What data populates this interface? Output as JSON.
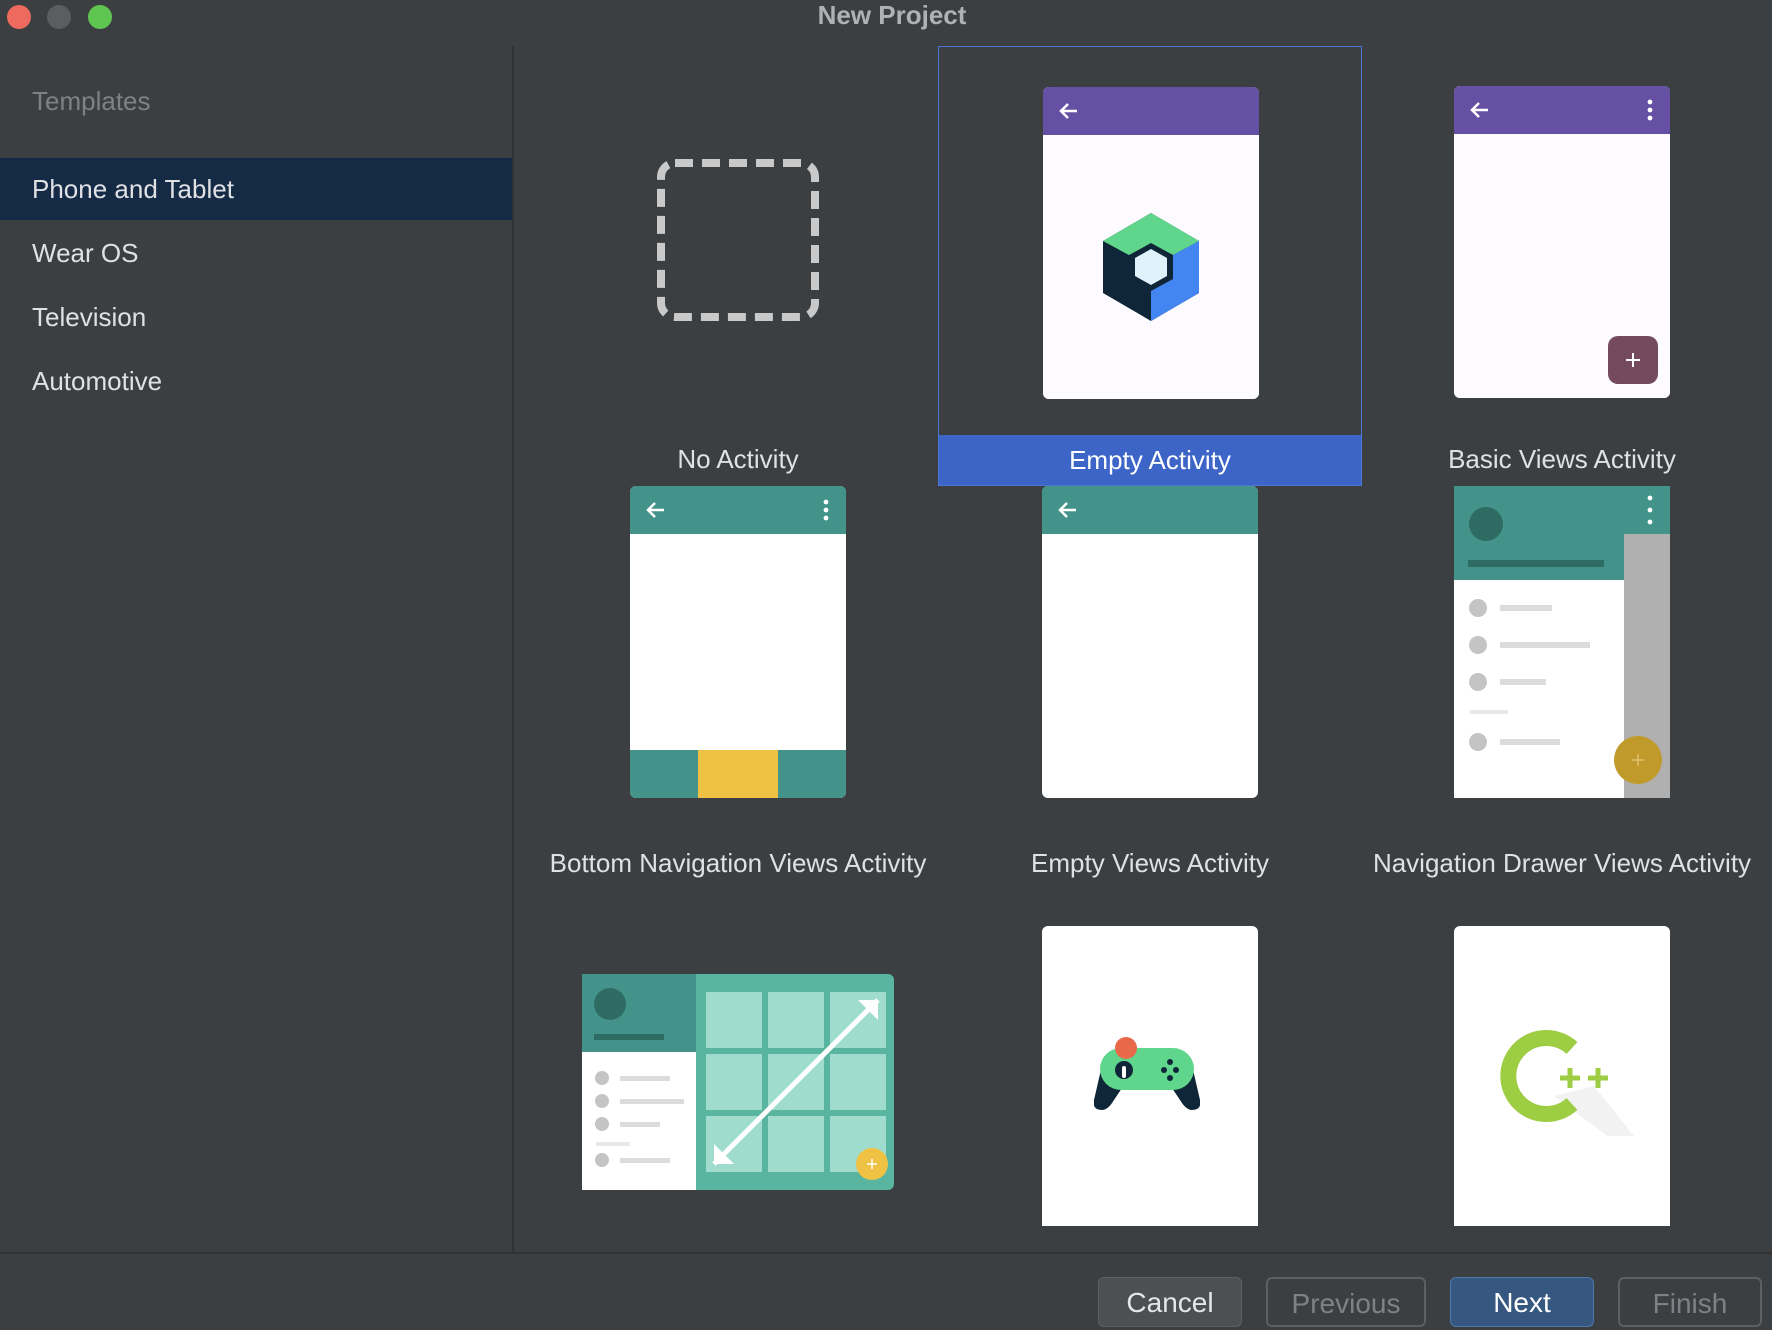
{
  "window": {
    "title": "New Project"
  },
  "sidebar": {
    "header": "Templates",
    "items": [
      {
        "label": "Phone and Tablet",
        "selected": true
      },
      {
        "label": "Wear OS",
        "selected": false
      },
      {
        "label": "Television",
        "selected": false
      },
      {
        "label": "Automotive",
        "selected": false
      }
    ]
  },
  "templates": [
    {
      "label": "No Activity",
      "icon": "dashed-square-icon"
    },
    {
      "label": "Empty Activity",
      "icon": "compose-logo-icon",
      "selected": true
    },
    {
      "label": "Basic Views Activity",
      "icon": "phone-fab-icon"
    },
    {
      "label": "Bottom Navigation Views Activity",
      "icon": "bottom-nav-icon"
    },
    {
      "label": "Empty Views Activity",
      "icon": "empty-phone-icon"
    },
    {
      "label": "Navigation Drawer Views Activity",
      "icon": "nav-drawer-icon"
    },
    {
      "label": "",
      "icon": "responsive-tablet-icon"
    },
    {
      "label": "",
      "icon": "game-controller-icon"
    },
    {
      "label": "",
      "icon": "cpp-logo-icon"
    }
  ],
  "buttons": {
    "cancel": "Cancel",
    "previous": "Previous",
    "next": "Next",
    "finish": "Finish"
  },
  "colors": {
    "selection_blue": "#3d65c7",
    "compose_purple": "#6650a4",
    "views_teal": "#43938a",
    "accent_yellow": "#f0c244",
    "primary_button": "#365880"
  }
}
